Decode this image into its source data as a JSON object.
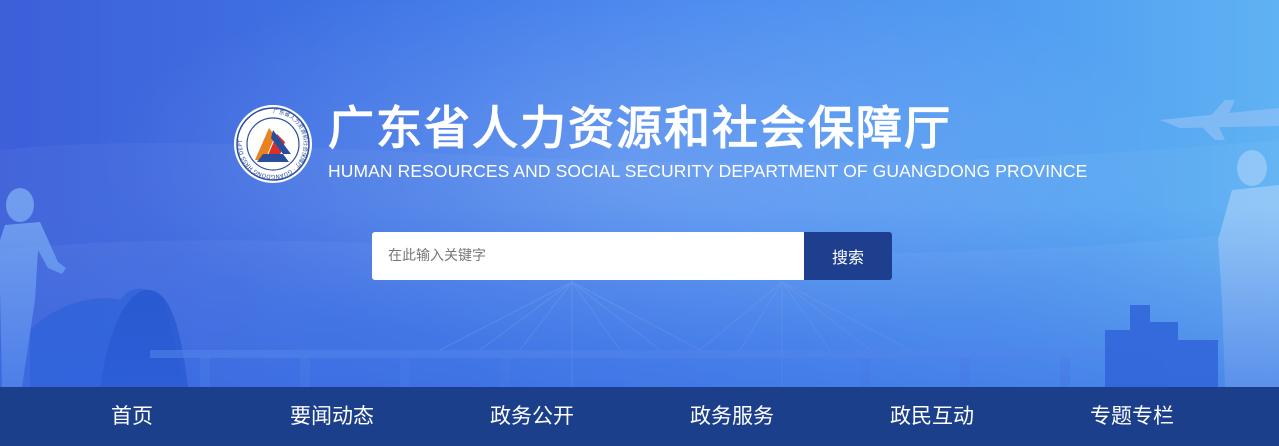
{
  "header": {
    "title_cn": "广东省人力资源和社会保障厅",
    "title_en": "HUMAN RESOURCES AND SOCIAL SECURITY DEPARTMENT OF GUANGDONG PROVINCE",
    "emblem_text": "广东省人力资源和社会保障厅 GUANGDONG HUMAN RESOURCES AND SOCIAL SECURITY DEPARTMENT"
  },
  "search": {
    "placeholder": "在此输入关键字",
    "value": "",
    "button_label": "搜索"
  },
  "nav": {
    "items": [
      {
        "label": "首页"
      },
      {
        "label": "要闻动态"
      },
      {
        "label": "政务公开"
      },
      {
        "label": "政务服务"
      },
      {
        "label": "政民互动"
      },
      {
        "label": "专题专栏"
      }
    ]
  },
  "colors": {
    "banner_blue": "#3f78e8",
    "nav_bg": "#1c3f8c",
    "search_button_bg": "#1d3f8e",
    "text_white": "#ffffff"
  },
  "icons": [
    "emblem-logo",
    "airplane-icon"
  ]
}
